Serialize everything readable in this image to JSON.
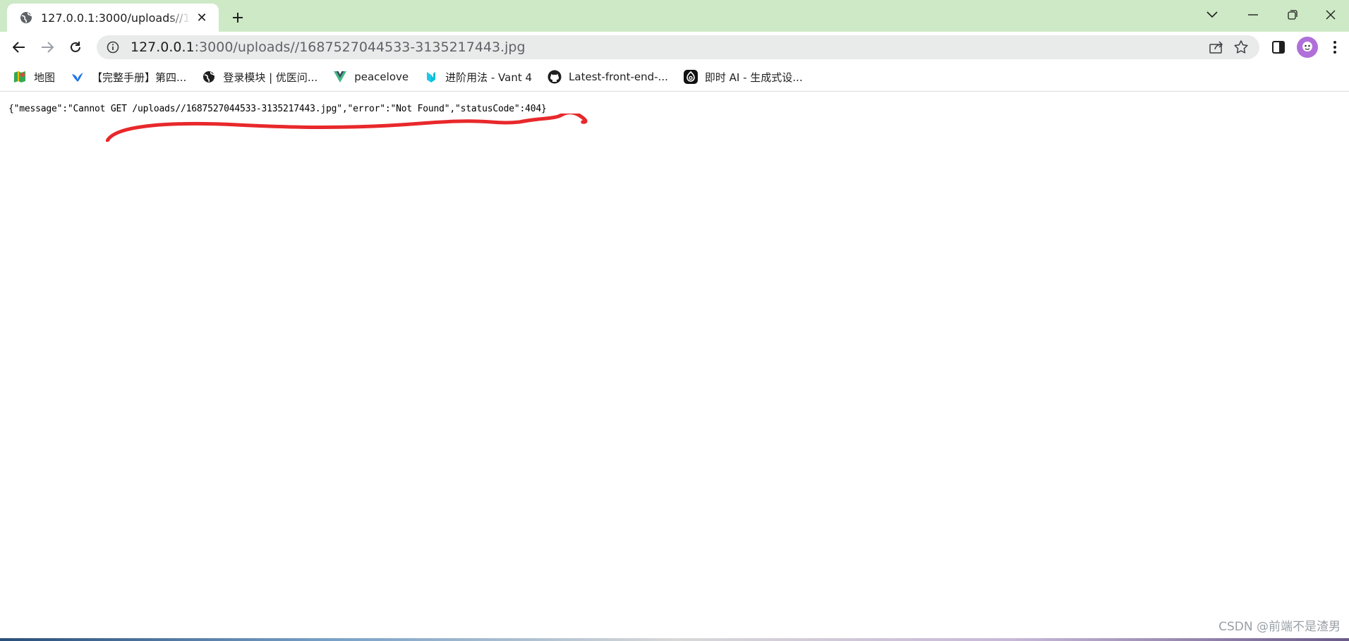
{
  "tab": {
    "title": "127.0.0.1:3000/uploads//1687527044533-3135217443.jpg",
    "close_glyph": "✕",
    "icon": "globe-icon"
  },
  "window_controls": {
    "tab_search": "chevron-down-icon",
    "minimize": "minimize-icon",
    "restore": "restore-icon",
    "close": "close-icon"
  },
  "toolbar": {
    "url_host": "127.0.0.1",
    "url_rest": ":3000/uploads//1687527044533-3135217443.jpg"
  },
  "bookmarks": [
    {
      "label": "地图",
      "icon": "maps-icon"
    },
    {
      "label": "【完整手册】第四...",
      "icon": "bird-icon"
    },
    {
      "label": "登录模块 | 优医问...",
      "icon": "globe-icon"
    },
    {
      "label": "peacelove",
      "icon": "vue-icon"
    },
    {
      "label": "进阶用法 - Vant 4",
      "icon": "vant-icon"
    },
    {
      "label": "Latest-front-end-...",
      "icon": "github-icon"
    },
    {
      "label": "即时 AI - 生成式设...",
      "icon": "ai-icon"
    }
  ],
  "content": {
    "json_text": "{\"message\":\"Cannot GET /uploads//1687527044533-3135217443.jpg\",\"error\":\"Not Found\",\"statusCode\":404}"
  },
  "watermark": "CSDN @前端不是渣男",
  "colors": {
    "tabstrip": "#cde9c5",
    "annotation": "#e8282b"
  }
}
